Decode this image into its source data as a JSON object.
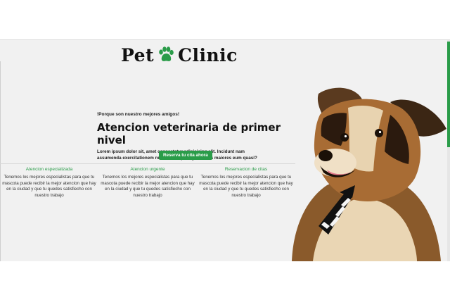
{
  "brand": {
    "name_left": "Pet",
    "name_right": "Clinic",
    "icon": "paw-icon",
    "accent_color": "#2a9c49"
  },
  "hero": {
    "tagline": "!Porque son nuestro mejores amigos!",
    "title": "Atencion veterinaria de primer nivel",
    "description": "Lorem ipsum dolor sit, amet consectetur adipisicing elit. Incidunt nam assumenda exercitationem nulla, amet qui fugiat facilis maiores eum quasi?",
    "cta_label": "Reserva tu cita ahora"
  },
  "features": [
    {
      "title": "Atencion especializada",
      "text": "Tenemos los mejores especialistas para que tu mascota puede recibir la mejor atencion que hay en la ciudad y que tu quedes satisfiecho con nuestro trabajo"
    },
    {
      "title": "Atencion urgente",
      "text": "Tenemos los mejores especialistas para que tu mascota puede recibir la mejor atencion que hay en la ciudad y que tu quedes satisfiecho con nuestro trabajo"
    },
    {
      "title": "Reservacion de citas",
      "text": "Tenemos los mejores especialistas para que tu mascota puede recibir la mejor atencion que hay en la ciudad y que tu quedes satisfiecho con nuestro trabajo"
    }
  ],
  "image": {
    "subject": "dog-with-striped-tie"
  }
}
